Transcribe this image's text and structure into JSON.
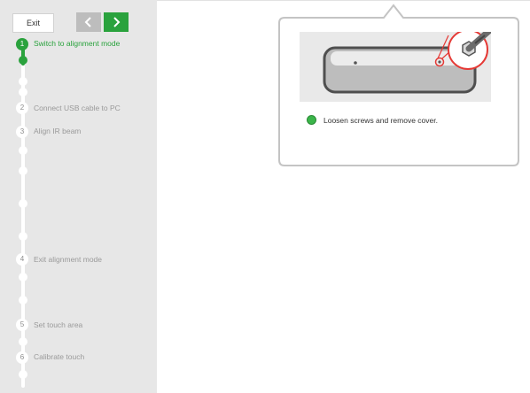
{
  "toolbar": {
    "exit_label": "Exit"
  },
  "steps": [
    {
      "number": "1",
      "label": "Switch to alignment mode",
      "state": "active"
    },
    {
      "number": "2",
      "label": "Connect USB cable to PC",
      "state": "pending"
    },
    {
      "number": "3",
      "label": "Align IR beam",
      "state": "pending"
    },
    {
      "number": "4",
      "label": "Exit alignment mode",
      "state": "pending"
    },
    {
      "number": "5",
      "label": "Set touch area",
      "state": "pending"
    },
    {
      "number": "6",
      "label": "Calibrate touch",
      "state": "pending"
    }
  ],
  "instruction": {
    "text": "Loosen screws and remove cover."
  },
  "colors": {
    "accent": "#2aa23d",
    "sidebar": "#e7e7e7",
    "nav_prev": "#bdbdbd",
    "highlight_ring": "#e53935"
  },
  "icons": {
    "prev": "chevron-left-icon",
    "next": "chevron-right-icon",
    "status": "status-dot-icon"
  }
}
